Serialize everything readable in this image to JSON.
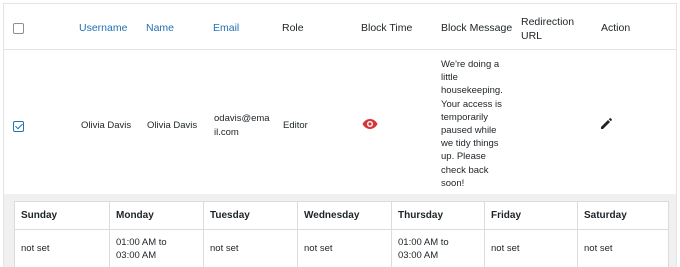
{
  "table": {
    "headers": {
      "username": "Username",
      "name": "Name",
      "email": "Email",
      "role": "Role",
      "block_time": "Block Time",
      "block_message": "Block Message",
      "redirection_url_line1": "Redirection",
      "redirection_url_line2": "URL",
      "action": "Action"
    },
    "select_all_checked": false,
    "row": {
      "selected": true,
      "username": "Olivia Davis",
      "name": "Olivia Davis",
      "email_line1": "odavis@ema",
      "email_line2": "il.com",
      "role": "Editor",
      "block_time_icon": "eye-icon",
      "block_message_lines": [
        "We're doing a",
        "little",
        "housekeeping.",
        "Your access is",
        "temporarily",
        "paused while",
        "we tidy things",
        "up. Please",
        "check back",
        "soon!"
      ],
      "redirection_url": "",
      "action_icon": "pencil-icon"
    }
  },
  "schedule": {
    "days": [
      {
        "day": "Sunday",
        "line1": "not set",
        "line2": ""
      },
      {
        "day": "Monday",
        "line1": "01:00 AM to",
        "line2": "03:00 AM"
      },
      {
        "day": "Tuesday",
        "line1": "not set",
        "line2": ""
      },
      {
        "day": "Wednesday",
        "line1": "not set",
        "line2": ""
      },
      {
        "day": "Thursday",
        "line1": "01:00 AM to",
        "line2": "03:00 AM"
      },
      {
        "day": "Friday",
        "line1": "not set",
        "line2": ""
      },
      {
        "day": "Saturday",
        "line1": "not set",
        "line2": ""
      }
    ]
  },
  "colors": {
    "link": "#2271b1",
    "eye_icon": "#d63638",
    "panel_bg": "#f0f0f1"
  }
}
